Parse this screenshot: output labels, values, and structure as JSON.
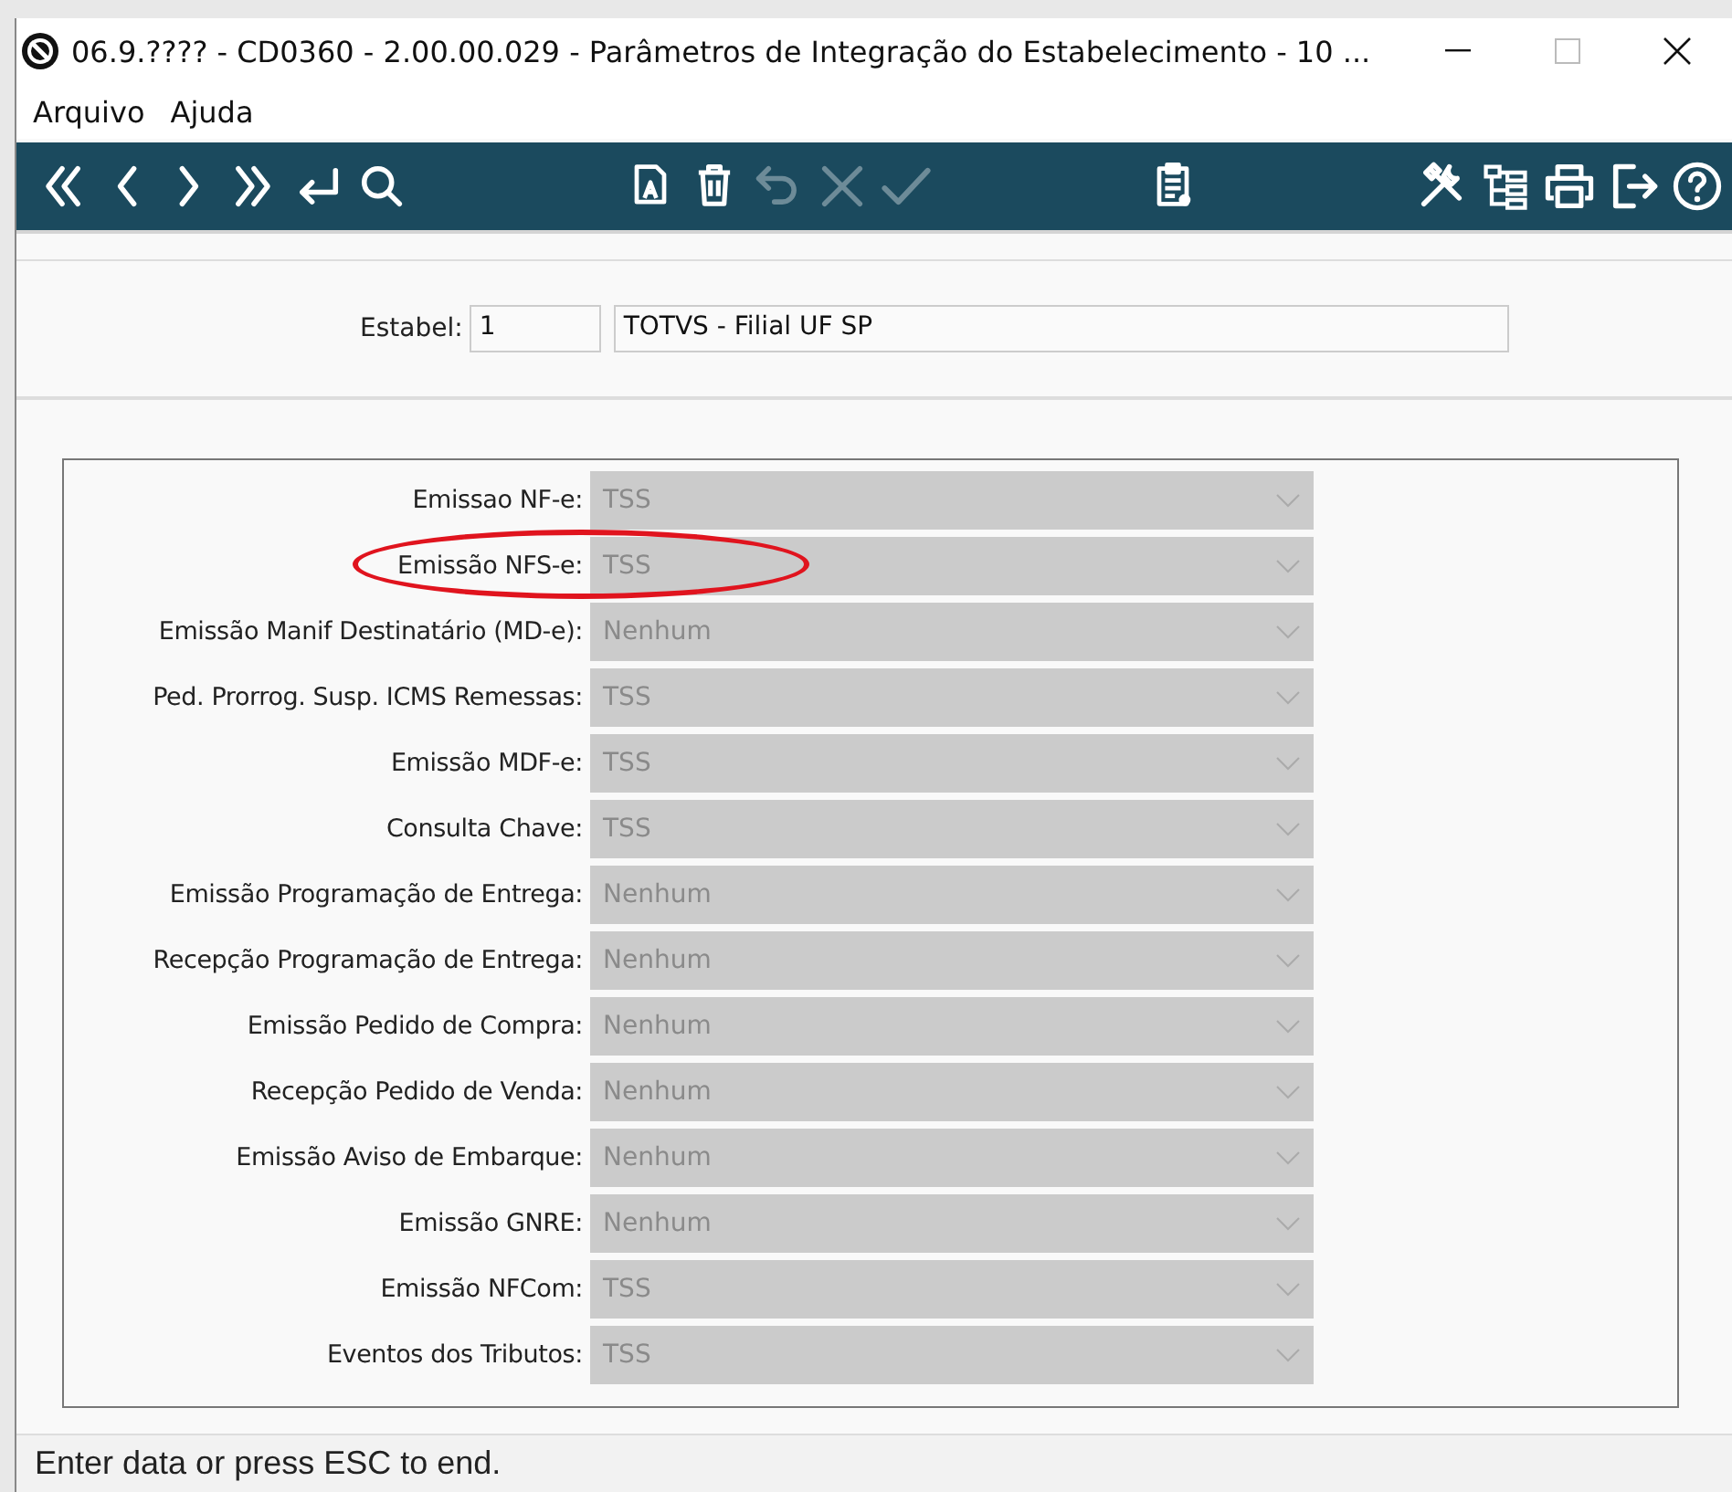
{
  "window": {
    "title": "06.9.???? - CD0360 - 2.00.00.029 - Parâmetros de Integração do Estabelecimento - 10 ..."
  },
  "menu": [
    "Arquivo",
    "Ajuda"
  ],
  "toolbar": [
    {
      "kind": "first",
      "disabled": false
    },
    {
      "kind": "prev",
      "disabled": false
    },
    {
      "kind": "next",
      "disabled": false
    },
    {
      "kind": "last",
      "disabled": false
    },
    {
      "kind": "goto",
      "disabled": false
    },
    {
      "kind": "search",
      "disabled": false
    },
    {
      "kind": "spacer"
    },
    {
      "kind": "edit",
      "disabled": false
    },
    {
      "kind": "delete",
      "disabled": false
    },
    {
      "kind": "undo",
      "disabled": true
    },
    {
      "kind": "cancel",
      "disabled": true
    },
    {
      "kind": "save",
      "disabled": true
    },
    {
      "kind": "spacer"
    },
    {
      "kind": "clipboard",
      "disabled": false
    },
    {
      "kind": "spacer"
    },
    {
      "kind": "tools",
      "disabled": false
    },
    {
      "kind": "tree",
      "disabled": false
    },
    {
      "kind": "print",
      "disabled": false
    },
    {
      "kind": "exit",
      "disabled": false
    },
    {
      "kind": "help",
      "disabled": false
    }
  ],
  "header": {
    "label": "Estabel:",
    "code": "1",
    "name": "TOTVS - Filial UF SP"
  },
  "rows": [
    {
      "label": "Emissao NF-e:",
      "value": "TSS",
      "disabled": true,
      "highlighted": false
    },
    {
      "label": "Emissão NFS-e:",
      "value": "TSS",
      "disabled": true,
      "highlighted": true
    },
    {
      "label": "Emissão Manif Destinatário (MD-e):",
      "value": "Nenhum",
      "disabled": true,
      "highlighted": false
    },
    {
      "label": "Ped. Prorrog. Susp. ICMS Remessas:",
      "value": "TSS",
      "disabled": true,
      "highlighted": false
    },
    {
      "label": "Emissão MDF-e:",
      "value": "TSS",
      "disabled": true,
      "highlighted": false
    },
    {
      "label": "Consulta Chave:",
      "value": "TSS",
      "disabled": true,
      "highlighted": false
    },
    {
      "label": "Emissão Programação de Entrega:",
      "value": "Nenhum",
      "disabled": true,
      "highlighted": false
    },
    {
      "label": "Recepção Programação de Entrega:",
      "value": "Nenhum",
      "disabled": true,
      "highlighted": false
    },
    {
      "label": "Emissão Pedido de Compra:",
      "value": "Nenhum",
      "disabled": true,
      "highlighted": false
    },
    {
      "label": "Recepção Pedido de Venda:",
      "value": "Nenhum",
      "disabled": true,
      "highlighted": false
    },
    {
      "label": "Emissão Aviso de Embarque:",
      "value": "Nenhum",
      "disabled": true,
      "highlighted": false
    },
    {
      "label": "Emissão GNRE:",
      "value": "Nenhum",
      "disabled": true,
      "highlighted": false
    },
    {
      "label": "Emissão NFCom:",
      "value": "TSS",
      "disabled": true,
      "highlighted": false
    },
    {
      "label": "Eventos dos Tributos:",
      "value": "TSS",
      "disabled": true,
      "highlighted": false
    }
  ],
  "status_bar": "Enter data or press ESC to end."
}
